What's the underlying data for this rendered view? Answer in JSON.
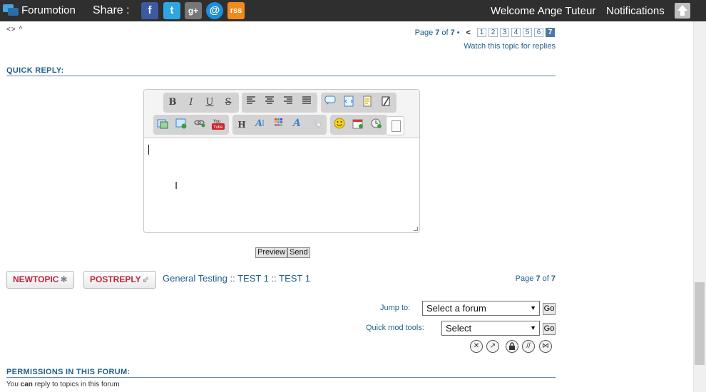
{
  "topbar": {
    "brand": "Forumotion",
    "share_label": "Share :",
    "social": {
      "facebook": "f",
      "twitter": "t",
      "googleplus": "g+",
      "email": "@",
      "rss": "rss"
    },
    "welcome": "Welcome Ange Tuteur",
    "notifications": "Notifications"
  },
  "top_nav": {
    "symbols": "<> ^"
  },
  "pagination": {
    "prefix": "Page",
    "current": "7",
    "of": "of",
    "total": "7",
    "bullet": "•",
    "prev": "<",
    "pages": [
      "1",
      "2",
      "3",
      "4",
      "5",
      "6",
      "7"
    ]
  },
  "watch_topic": "Watch this topic for replies",
  "quick_reply": {
    "title": "QUICK REPLY:",
    "toolbar": {
      "bold": "B",
      "italic": "I",
      "underline": "U",
      "strike": "S",
      "header": "H"
    }
  },
  "buttons": {
    "preview": "Preview",
    "send": "Send",
    "new_topic": "NEWTOPIC",
    "post_reply": "POSTREPLY"
  },
  "breadcrumb": {
    "items": [
      "General Testing",
      "TEST 1",
      "TEST 1"
    ],
    "separator": "::"
  },
  "bottom_page": {
    "prefix": "Page",
    "current": "7",
    "of": "of",
    "total": "7"
  },
  "jump_to": {
    "label": "Jump to:",
    "value": "Select a forum",
    "go": "Go"
  },
  "quick_mod": {
    "label": "Quick mod tools:",
    "value": "Select",
    "go": "Go"
  },
  "permissions": {
    "title": "PERMISSIONS IN THIS FORUM:",
    "line1_a": "You ",
    "line1_b": "can",
    "line1_c": " reply to topics in this forum"
  }
}
